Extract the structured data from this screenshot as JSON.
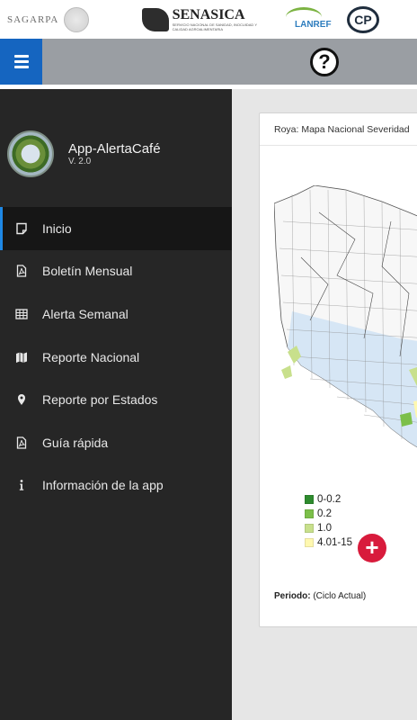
{
  "header": {
    "logos": {
      "sagarpa": "SAGARPA",
      "senasica": "SENASICA",
      "senasica_sub": "SERVICIO NACIONAL DE SANIDAD, INOCUIDAD Y CALIDAD AGROALIMENTARIA",
      "lanref": "LANREF",
      "cp": "CP"
    }
  },
  "toolbar": {
    "menu_icon": "hamburger-icon",
    "help_label": "?"
  },
  "sidebar": {
    "app_title": "App-AlertaCafé",
    "app_version": "V. 2.0",
    "items": [
      {
        "label": "Inicio",
        "icon": "note-icon",
        "active": true
      },
      {
        "label": "Boletín Mensual",
        "icon": "pdf-icon",
        "active": false
      },
      {
        "label": "Alerta Semanal",
        "icon": "table-icon",
        "active": false
      },
      {
        "label": "Reporte Nacional",
        "icon": "map-icon",
        "active": false
      },
      {
        "label": "Reporte por Estados",
        "icon": "map-marker-icon",
        "active": false
      },
      {
        "label": "Guía rápida",
        "icon": "pdf-icon",
        "active": false
      },
      {
        "label": "Información de la app",
        "icon": "info-icon",
        "active": false
      }
    ]
  },
  "card": {
    "title": "Roya: Mapa Nacional Severidad",
    "legend": [
      {
        "label": "0-0.2",
        "color": "#2e8b2e"
      },
      {
        "label": "0.2",
        "color": "#7cbf4a"
      },
      {
        "label": "1.0",
        "color": "#c8e08c"
      },
      {
        "label": "4.01-15",
        "color": "#fff8b0"
      }
    ],
    "period_label": "Periodo:",
    "period_value": "(Ciclo Actual)"
  },
  "colors": {
    "sidebar_bg": "#262626",
    "toolbar_bg": "#9a9ea3",
    "accent": "#1565c0",
    "fab": "#d81b3c"
  }
}
